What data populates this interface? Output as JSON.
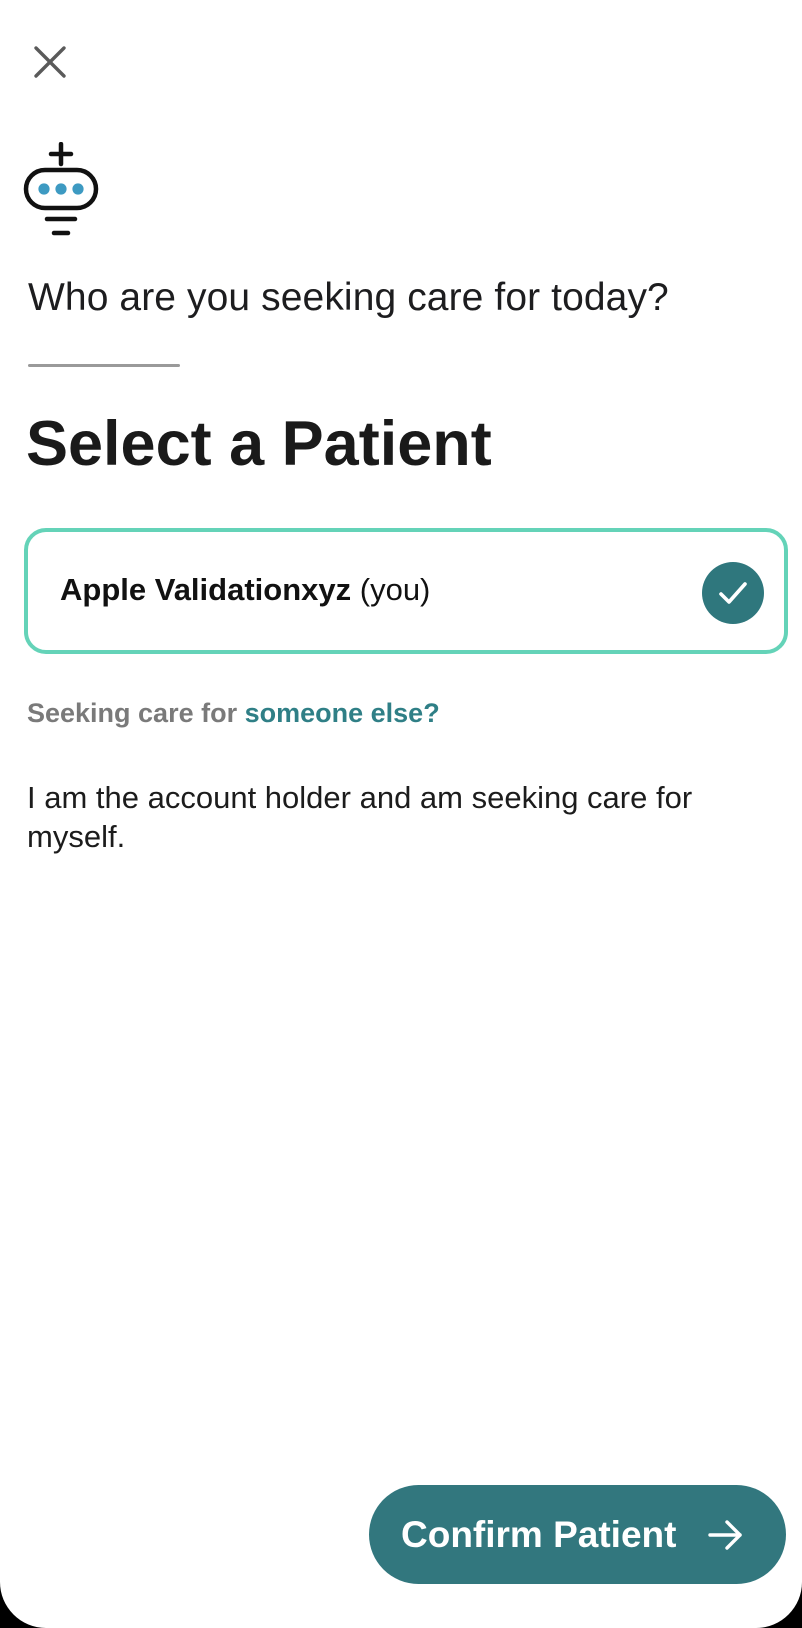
{
  "header": {
    "close_icon": "close-icon",
    "logo_icon": "chat-plus-logo-icon"
  },
  "main": {
    "question": "Who are you seeking care for today?",
    "heading": "Select a Patient",
    "patient": {
      "name": "Apple Validationxyz",
      "suffix": "(you)",
      "selected": true,
      "check_icon": "checkmark-icon"
    },
    "someone_else": {
      "prefix": "Seeking care for",
      "link": "someone else?"
    },
    "description": "I am the account holder and am seeking care for myself."
  },
  "footer": {
    "confirm_label": "Confirm Patient",
    "arrow_icon": "arrow-right-icon"
  },
  "colors": {
    "accent": "#32777e",
    "selected_border": "#64d3b8",
    "link": "#2f7f86",
    "logo_dots": "#3d9ac2"
  }
}
